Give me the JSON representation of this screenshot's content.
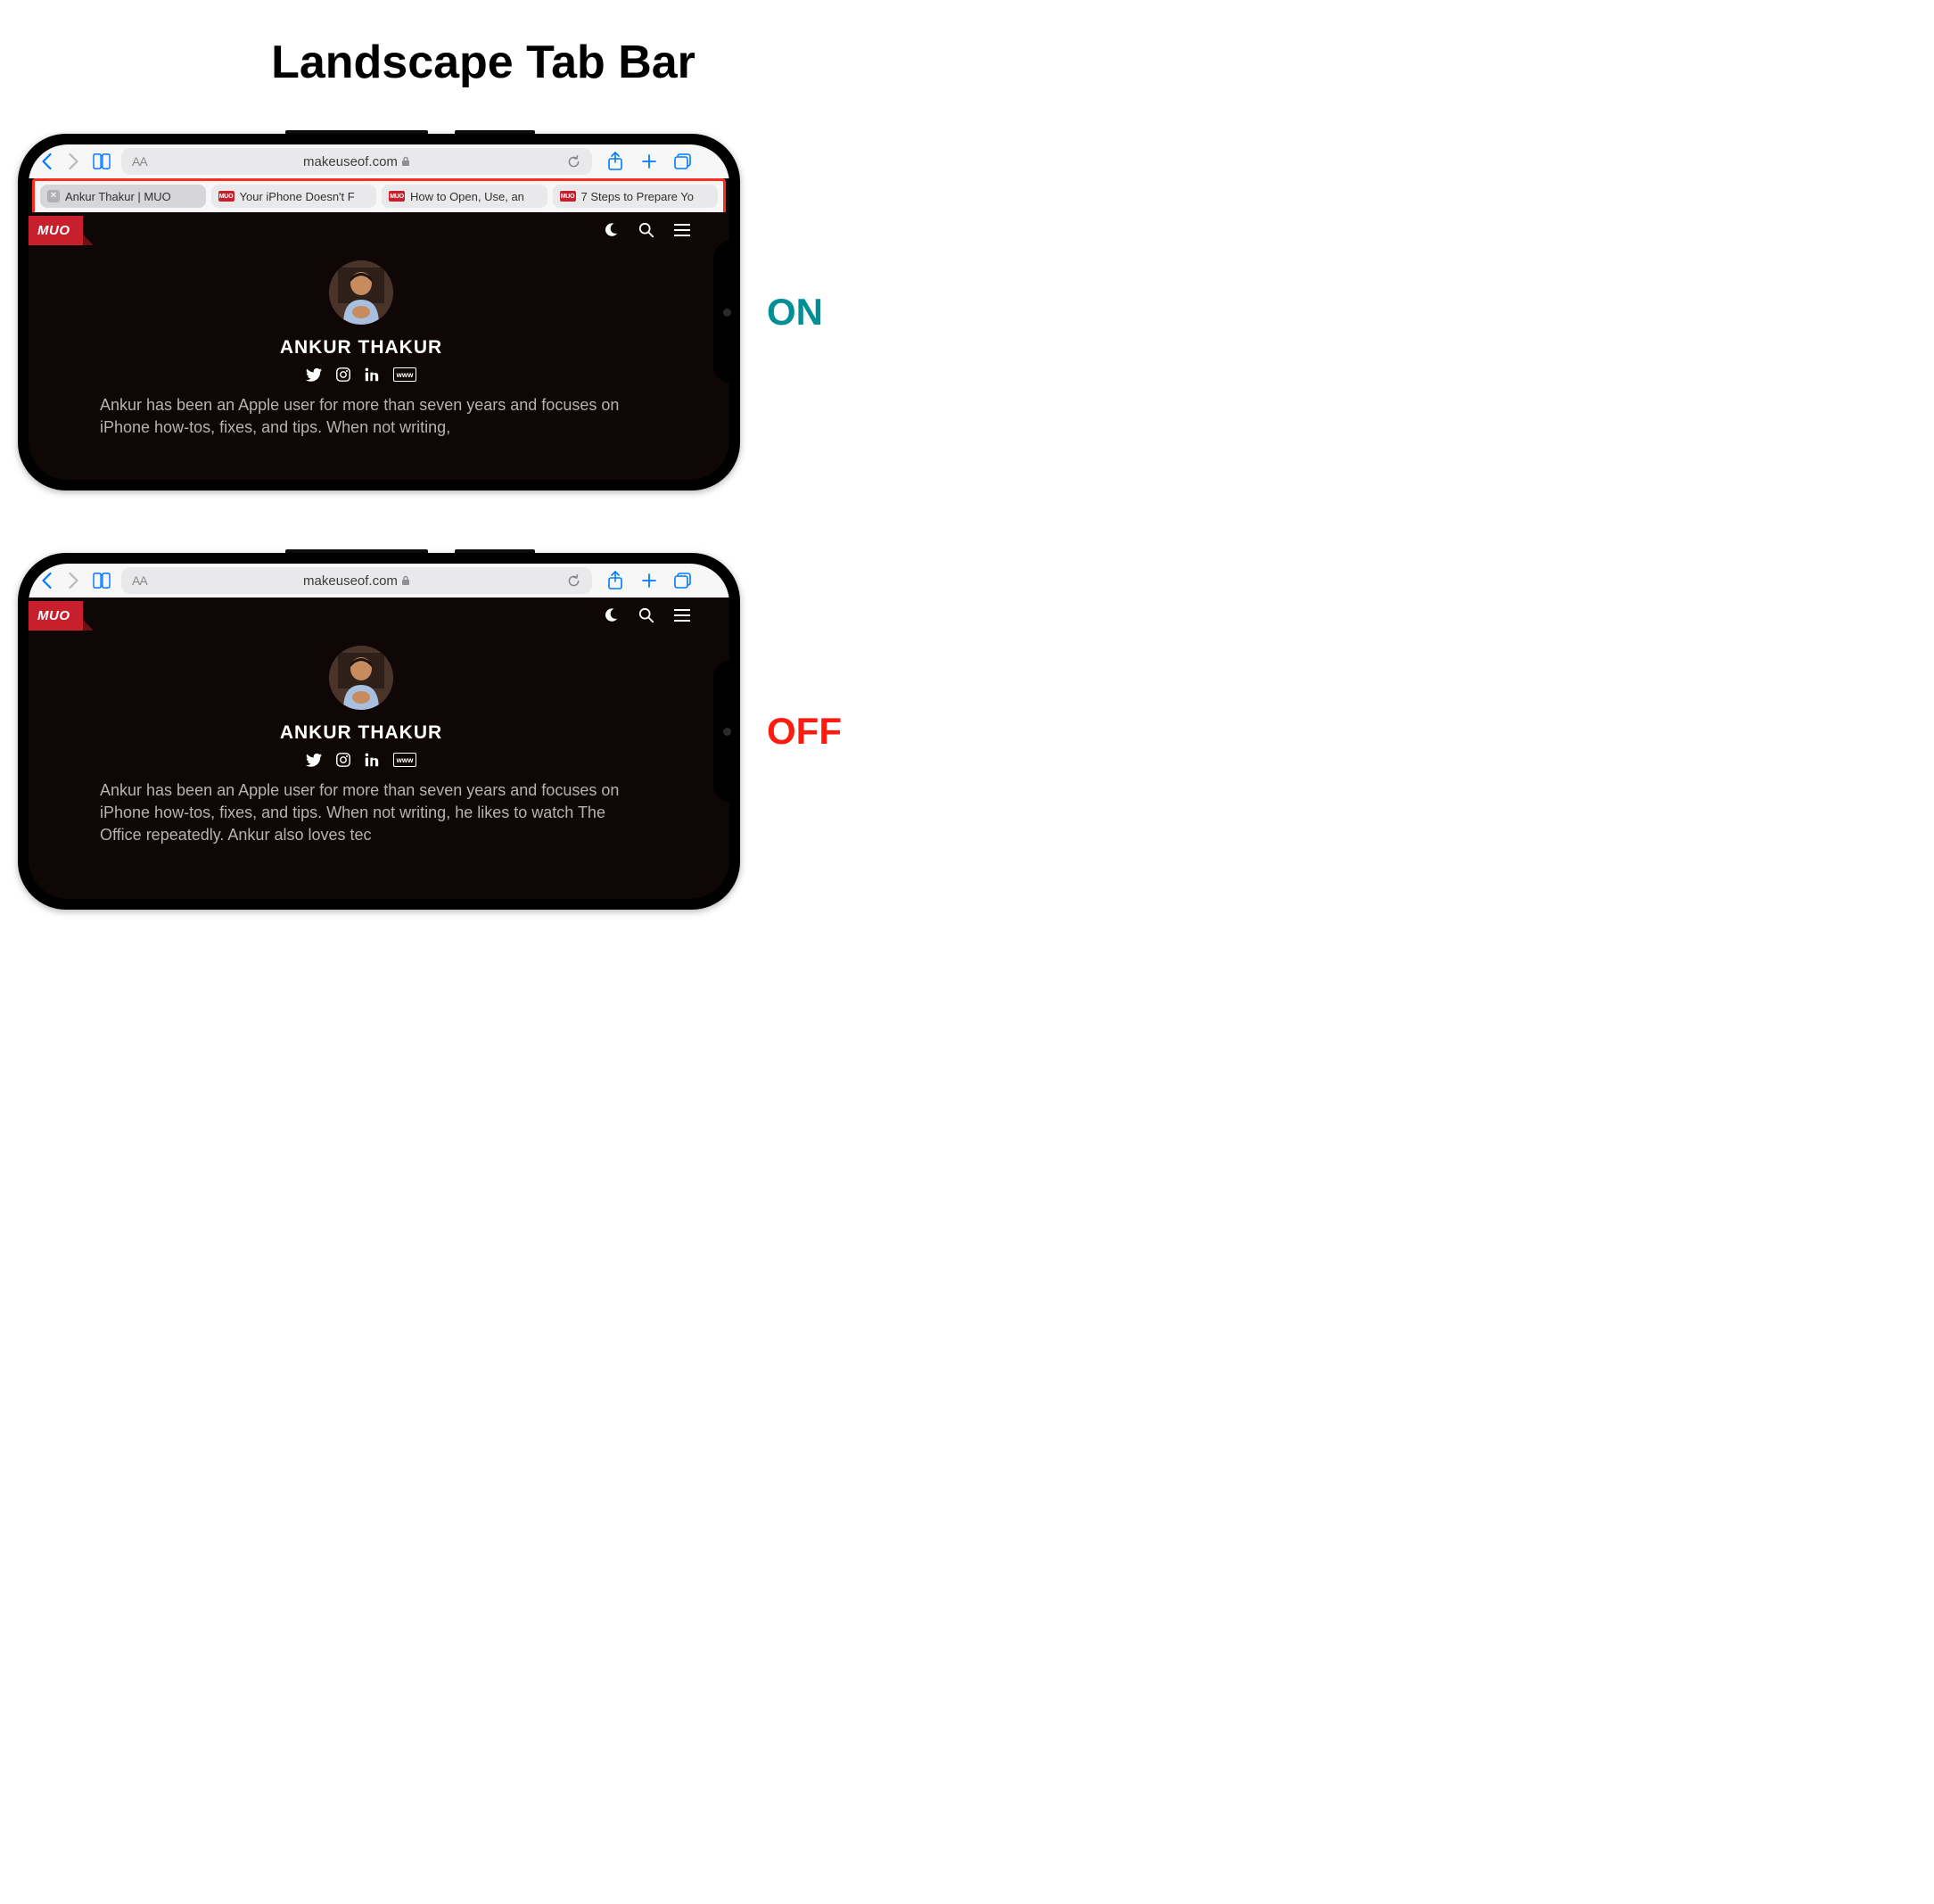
{
  "title": "Landscape Tab Bar",
  "labels": {
    "on": "ON",
    "off": "OFF"
  },
  "safari": {
    "url_host": "makeuseof.com",
    "aa": "AA"
  },
  "tabs": [
    {
      "label": "Ankur Thakur | MUO",
      "active": true
    },
    {
      "label": "Your iPhone Doesn't F"
    },
    {
      "label": "How to Open, Use, an"
    },
    {
      "label": "7 Steps to Prepare Yo"
    }
  ],
  "page": {
    "logo": "MUO",
    "author": "ANKUR THAKUR",
    "bio_on": "Ankur has been an Apple user for more than seven years and focuses on iPhone how-tos, fixes, and tips. When not writing,",
    "bio_off": "Ankur has been an Apple user for more than seven years and focuses on iPhone how-tos, fixes, and tips. When not writing, he likes to watch The Office repeatedly. Ankur also loves tec",
    "www": "www"
  }
}
